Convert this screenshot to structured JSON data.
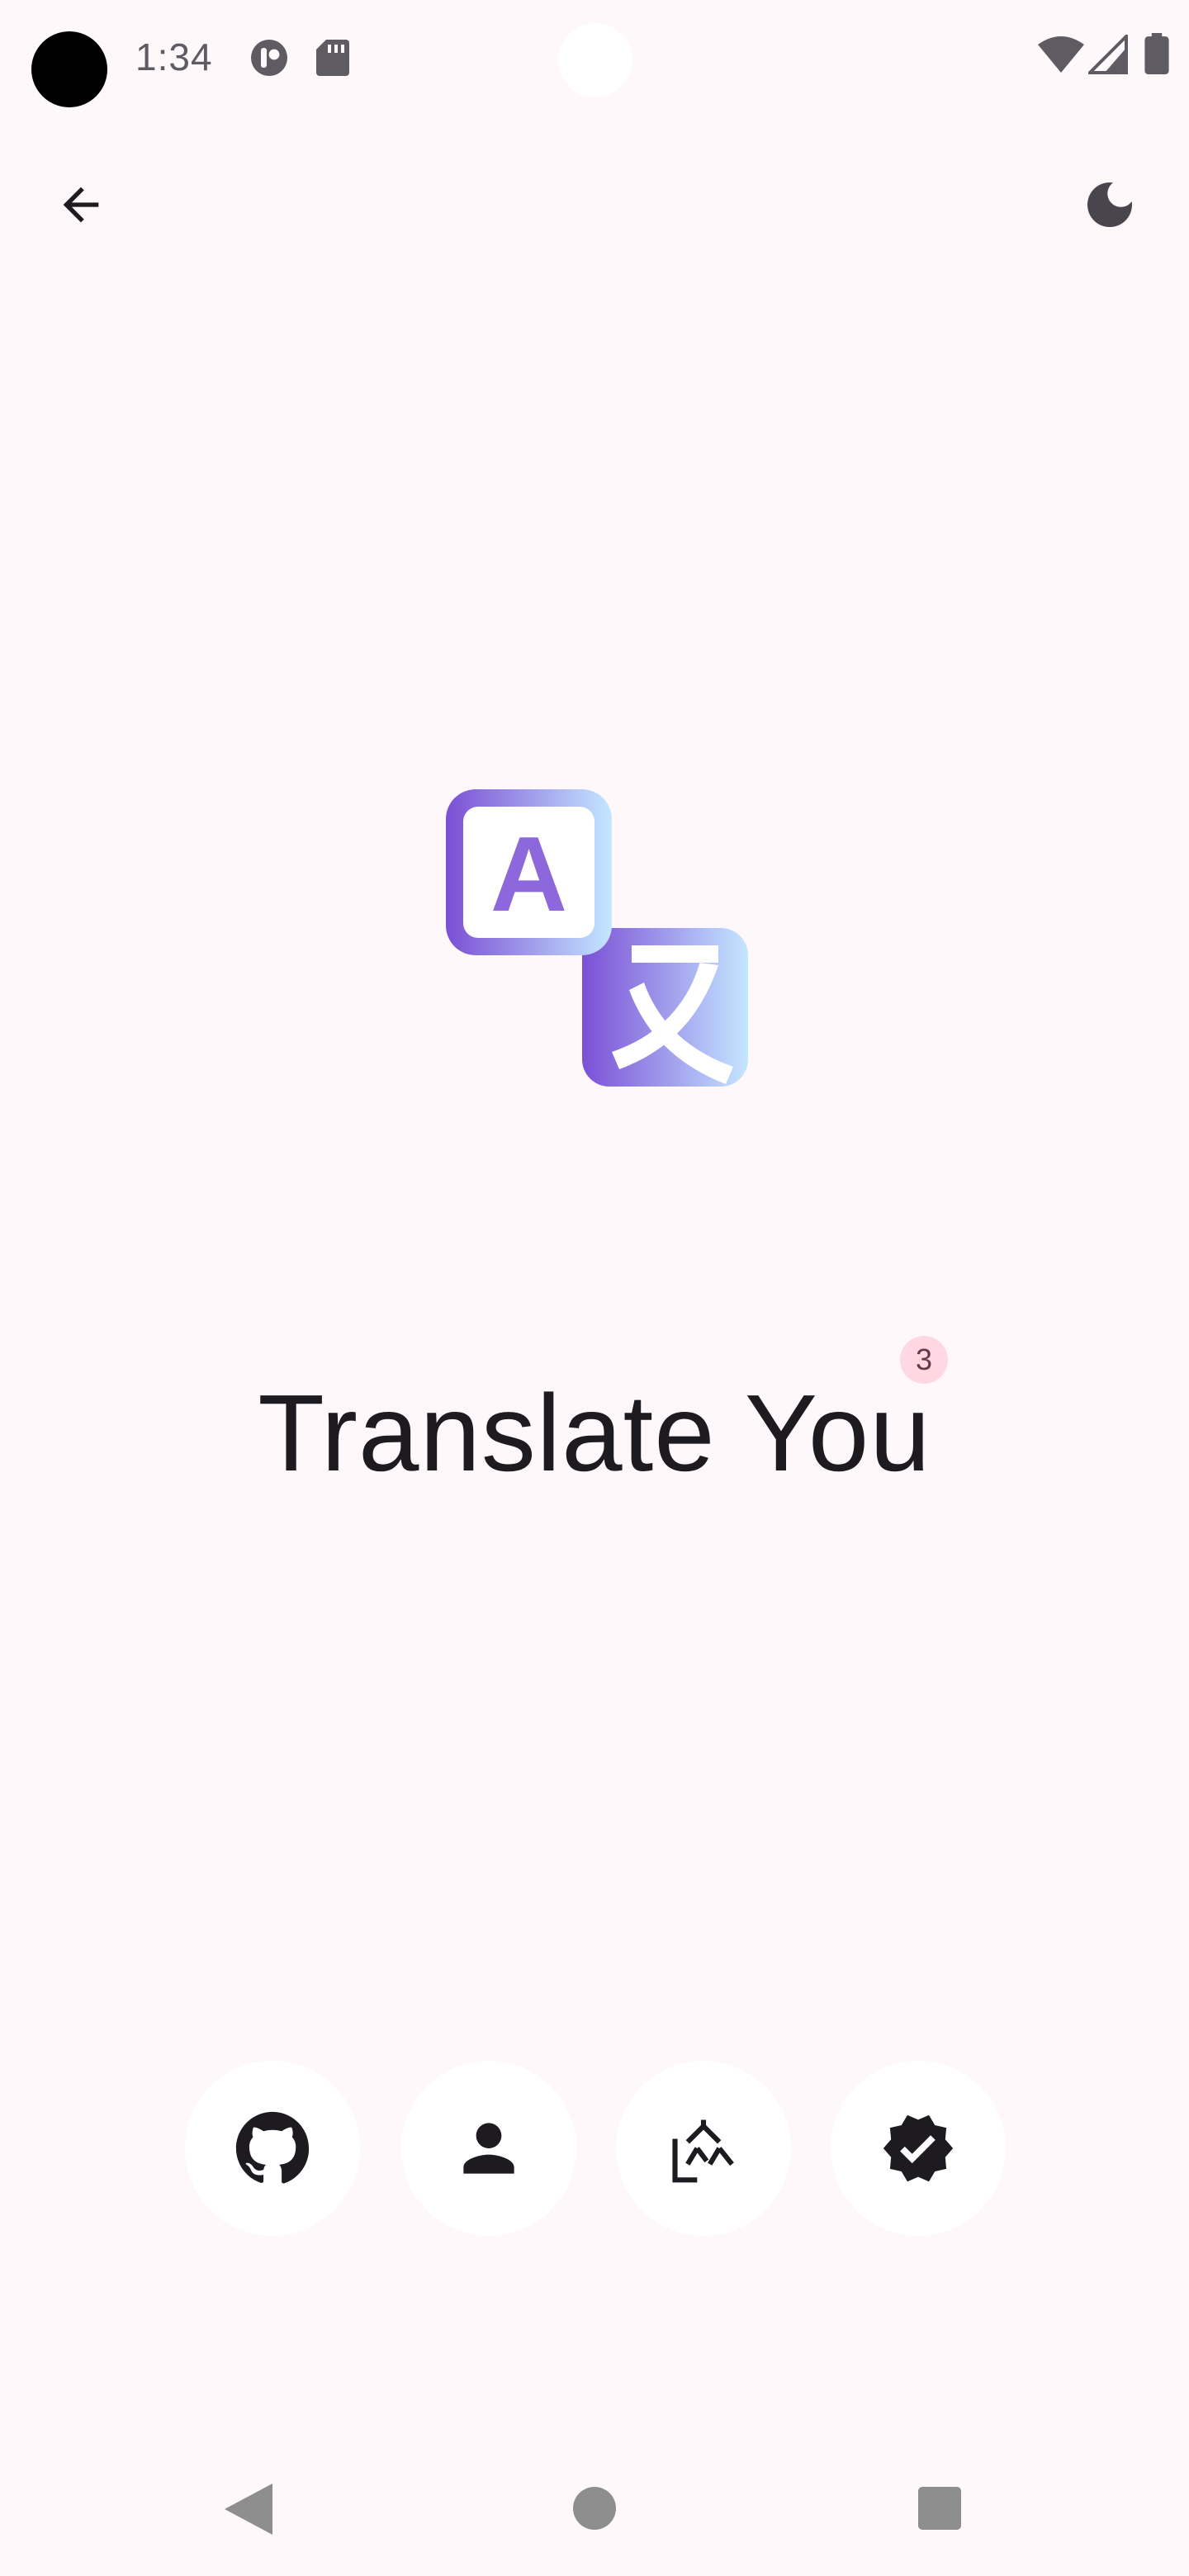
{
  "status_bar": {
    "time": "1:34",
    "icons": [
      "camera-cutout",
      "app-notification-icon",
      "sd-card-icon",
      "wifi-icon",
      "signal-icon",
      "battery-icon"
    ]
  },
  "top_bar": {
    "back_icon": "arrow-back-icon",
    "theme_icon": "dark-mode-moon-icon"
  },
  "logo": {
    "icon": "translate-logo-icon",
    "letter": "A",
    "gradient_start": "#7b4fd6",
    "gradient_end": "#c4e7ff"
  },
  "title": {
    "text": "Translate You",
    "badge": "3"
  },
  "actions": [
    {
      "id": "github",
      "icon": "github-icon"
    },
    {
      "id": "profile",
      "icon": "person-icon"
    },
    {
      "id": "translate",
      "icon": "translate-icon"
    },
    {
      "id": "verified",
      "icon": "verified-badge-icon"
    }
  ],
  "navigation": {
    "back": "nav-back-triangle",
    "home": "nav-home-circle",
    "recents": "nav-recents-square"
  },
  "colors": {
    "background": "#fff8fb",
    "text": "#1d1b20",
    "badge_bg": "#ffd8e4",
    "badge_text": "#633b48",
    "button_bg": "#ffffff"
  }
}
